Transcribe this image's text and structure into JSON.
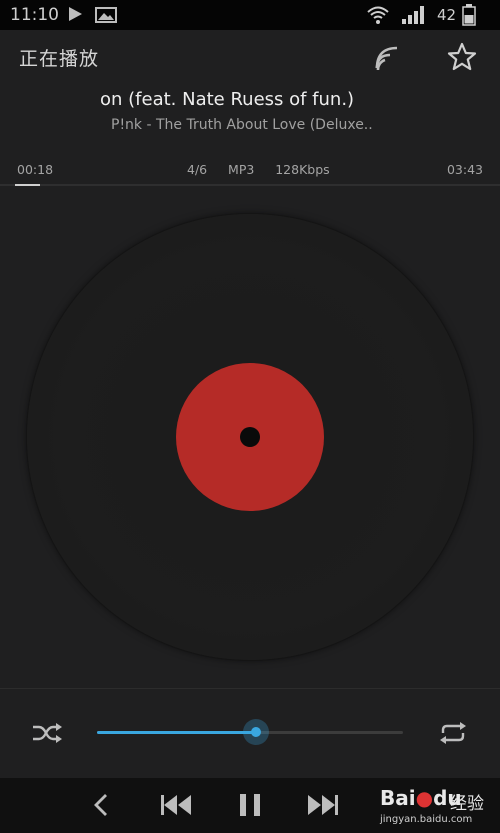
{
  "status_bar": {
    "time": "11:10",
    "battery": "42"
  },
  "header": {
    "title": "正在播放"
  },
  "now_playing": {
    "title": "on (feat. Nate Ruess of fun.)",
    "artist_album": "P!nk - The Truth About Love (Deluxe..",
    "elapsed": "00:18",
    "track_info": "4/6   MP3   128Kbps",
    "duration": "03:43",
    "progress_fraction": 0.08
  },
  "seek": {
    "fraction": 0.52
  },
  "colors": {
    "accent": "#3aa7e0",
    "label": "#b52b27",
    "background": "#1f1f20"
  },
  "icons": {
    "shuffle": "shuffle-icon",
    "repeat": "repeat-icon",
    "cast": "cast-icon",
    "favorite": "star-icon",
    "back": "back-icon",
    "prev": "previous-icon",
    "pause": "pause-icon",
    "next": "next-icon"
  },
  "watermark": {
    "logo_text": "Bai",
    "logo_text2": "du",
    "jy": "经验",
    "site": "jingyan.baidu.com"
  }
}
